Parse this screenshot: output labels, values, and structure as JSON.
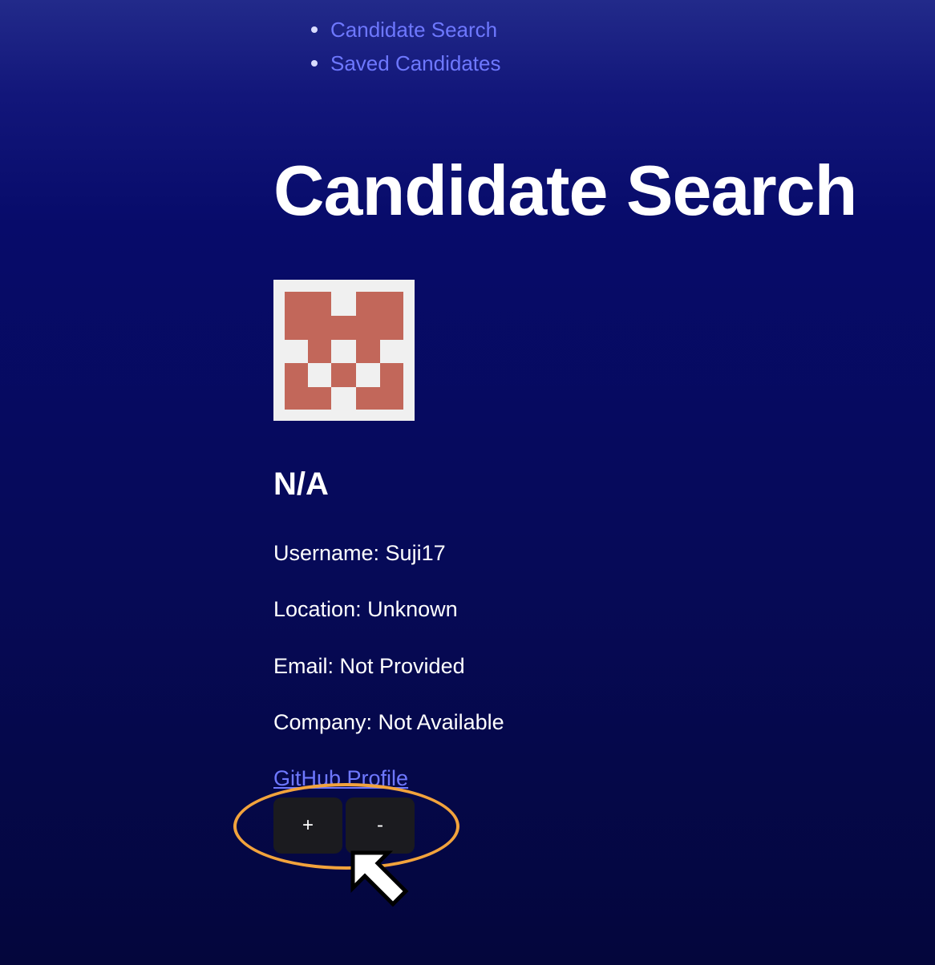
{
  "nav": {
    "items": [
      {
        "label": "Candidate Search"
      },
      {
        "label": "Saved Candidates"
      }
    ]
  },
  "page": {
    "title": "Candidate Search"
  },
  "candidate": {
    "avatar_icon": "identicon-avatar",
    "name": "N/A",
    "username": "Username: Suji17",
    "location": "Location: Unknown",
    "email": "Email: Not Provided",
    "company": "Company: Not Available",
    "profile_link": "GitHub Profile"
  },
  "actions": {
    "add_label": "+",
    "remove_label": "-"
  },
  "colors": {
    "link": "#6e78ff",
    "avatar_fill": "#c2675a",
    "avatar_bg": "#f0f0f0",
    "button_bg": "#1b1b1f",
    "highlight": "#f2a33c"
  }
}
